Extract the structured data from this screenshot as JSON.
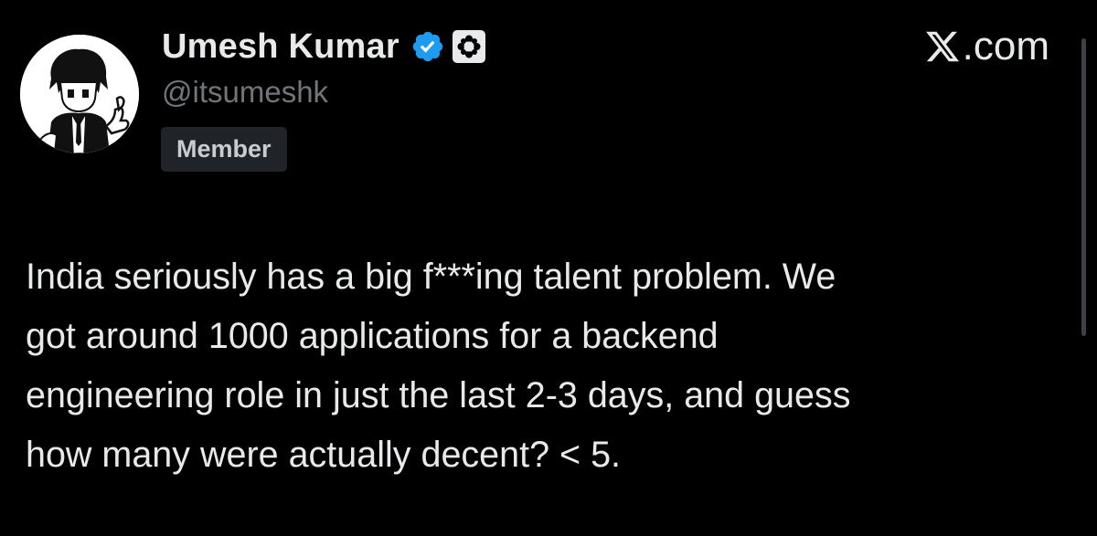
{
  "author": {
    "display_name": "Umesh Kumar",
    "handle": "@itsumeshk",
    "badge": "Member",
    "verified_icon": "verified-badge-icon",
    "affiliate_icon": "affiliate-org-icon"
  },
  "brand": {
    "label": ".com",
    "icon": "x-logo-icon"
  },
  "tweet": {
    "lines": [
      "India seriously has a big f***ing talent problem. We",
      "got around 1000 applications for a backend",
      "engineering role in just the last 2-3 days, and guess",
      "how many were actually decent? < 5."
    ]
  },
  "colors": {
    "background": "#000000",
    "text": "#e7e9ea",
    "secondary": "#71767b",
    "verified": "#1d9bf0",
    "badge_bg": "#202327"
  }
}
